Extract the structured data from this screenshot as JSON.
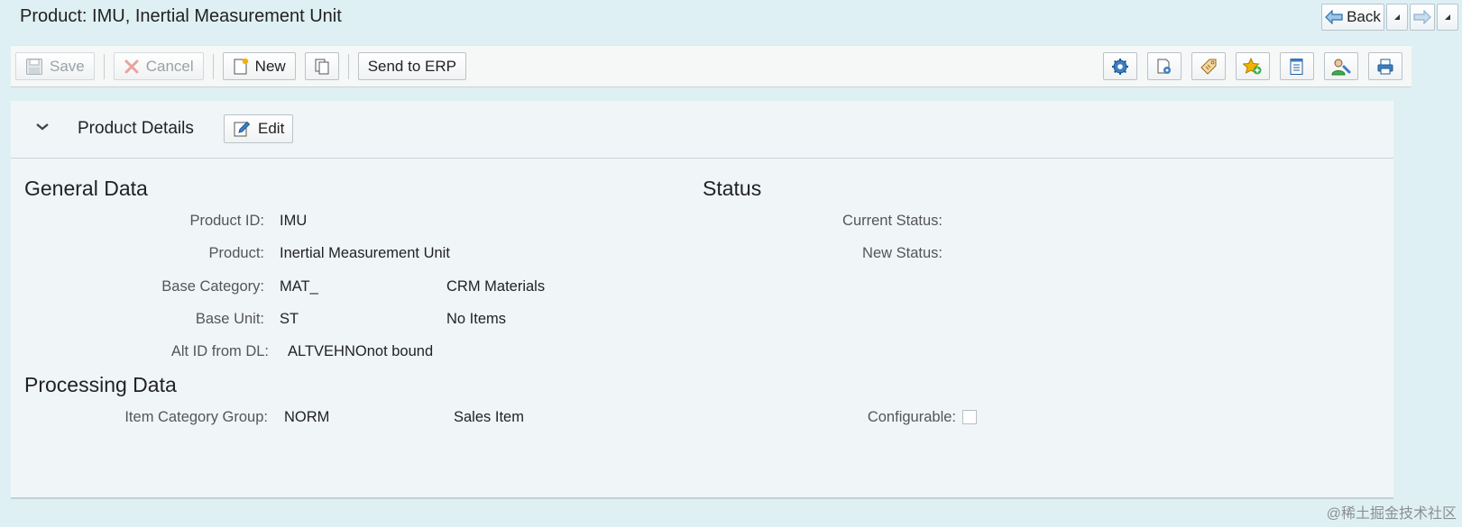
{
  "page": {
    "title": "Product: IMU, Inertial Measurement Unit"
  },
  "nav": {
    "back_label": "Back"
  },
  "toolbar": {
    "save_label": "Save",
    "cancel_label": "Cancel",
    "new_label": "New",
    "send_label": "Send to ERP",
    "right_icons": [
      "settings-icon",
      "personalize-icon",
      "tag-icon",
      "favorite-add-icon",
      "notes-icon",
      "user-config-icon",
      "print-icon"
    ]
  },
  "panel": {
    "title": "Product Details",
    "edit_label": "Edit"
  },
  "general": {
    "heading": "General Data",
    "product_id_label": "Product ID:",
    "product_id": "IMU",
    "product_label": "Product:",
    "product": "Inertial Measurement Unit",
    "base_category_label": "Base Category:",
    "base_category": "MAT_",
    "base_category_desc": "CRM Materials",
    "base_unit_label": "Base Unit:",
    "base_unit": "ST",
    "base_unit_desc": "No Items",
    "alt_id_label": "Alt ID from DL:",
    "alt_id": "ALTVEHNOnot bound"
  },
  "status": {
    "heading": "Status",
    "current_label": "Current Status:",
    "new_label": "New Status:"
  },
  "processing": {
    "heading": "Processing Data",
    "item_cat_label": "Item Category Group:",
    "item_cat": "NORM",
    "item_cat_desc": "Sales Item",
    "configurable_label": "Configurable:"
  },
  "watermark": "@稀土掘金技术社区",
  "colors": {
    "accent": "#1e6fb8",
    "star": "#f0b400"
  }
}
